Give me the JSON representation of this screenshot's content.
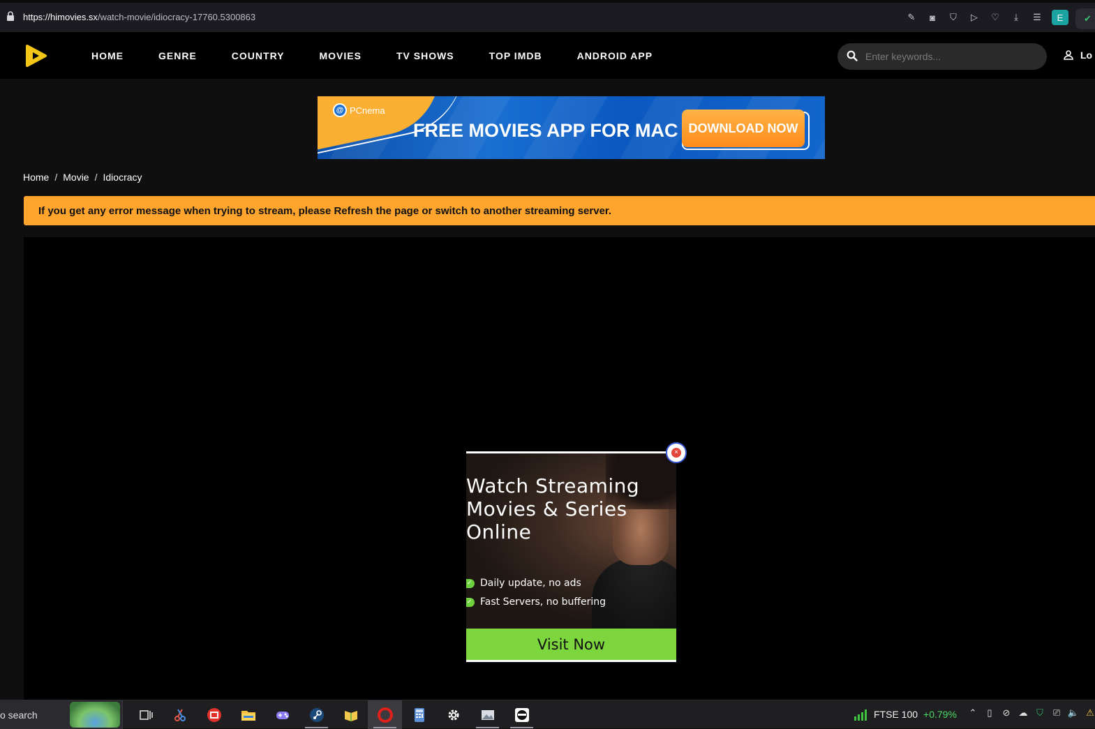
{
  "browser": {
    "url_host": "https://himovies.sx",
    "url_path": "/watch-movie/idiocracy-17760.5300863",
    "extension_badge": "E"
  },
  "site": {
    "nav": [
      {
        "label": "HOME"
      },
      {
        "label": "GENRE"
      },
      {
        "label": "COUNTRY"
      },
      {
        "label": "MOVIES"
      },
      {
        "label": "TV SHOWS"
      },
      {
        "label": "TOP IMDB"
      },
      {
        "label": "ANDROID APP"
      }
    ],
    "search_placeholder": "Enter keywords...",
    "login_label": "Lo",
    "accent_color": "#ffa52e"
  },
  "banner": {
    "brand": "PCnema",
    "headline": "FREE MOVIES APP FOR MAC",
    "cta": "DOWNLOAD NOW"
  },
  "breadcrumb": {
    "items": [
      "Home",
      "Movie",
      "Idiocracy"
    ],
    "separator": "/"
  },
  "notice": {
    "text": "If you get any error message when trying to stream, please Refresh the page or switch to another streaming server."
  },
  "popup": {
    "title_lines": [
      "Watch Streaming",
      "Movies & Series",
      "Online"
    ],
    "features": [
      "Daily update, no ads",
      "Fast Servers, no buffering"
    ],
    "cta": "Visit Now"
  },
  "taskbar": {
    "search_text": "o search",
    "ticker_name": "FTSE 100",
    "ticker_change": "+0.79%"
  }
}
